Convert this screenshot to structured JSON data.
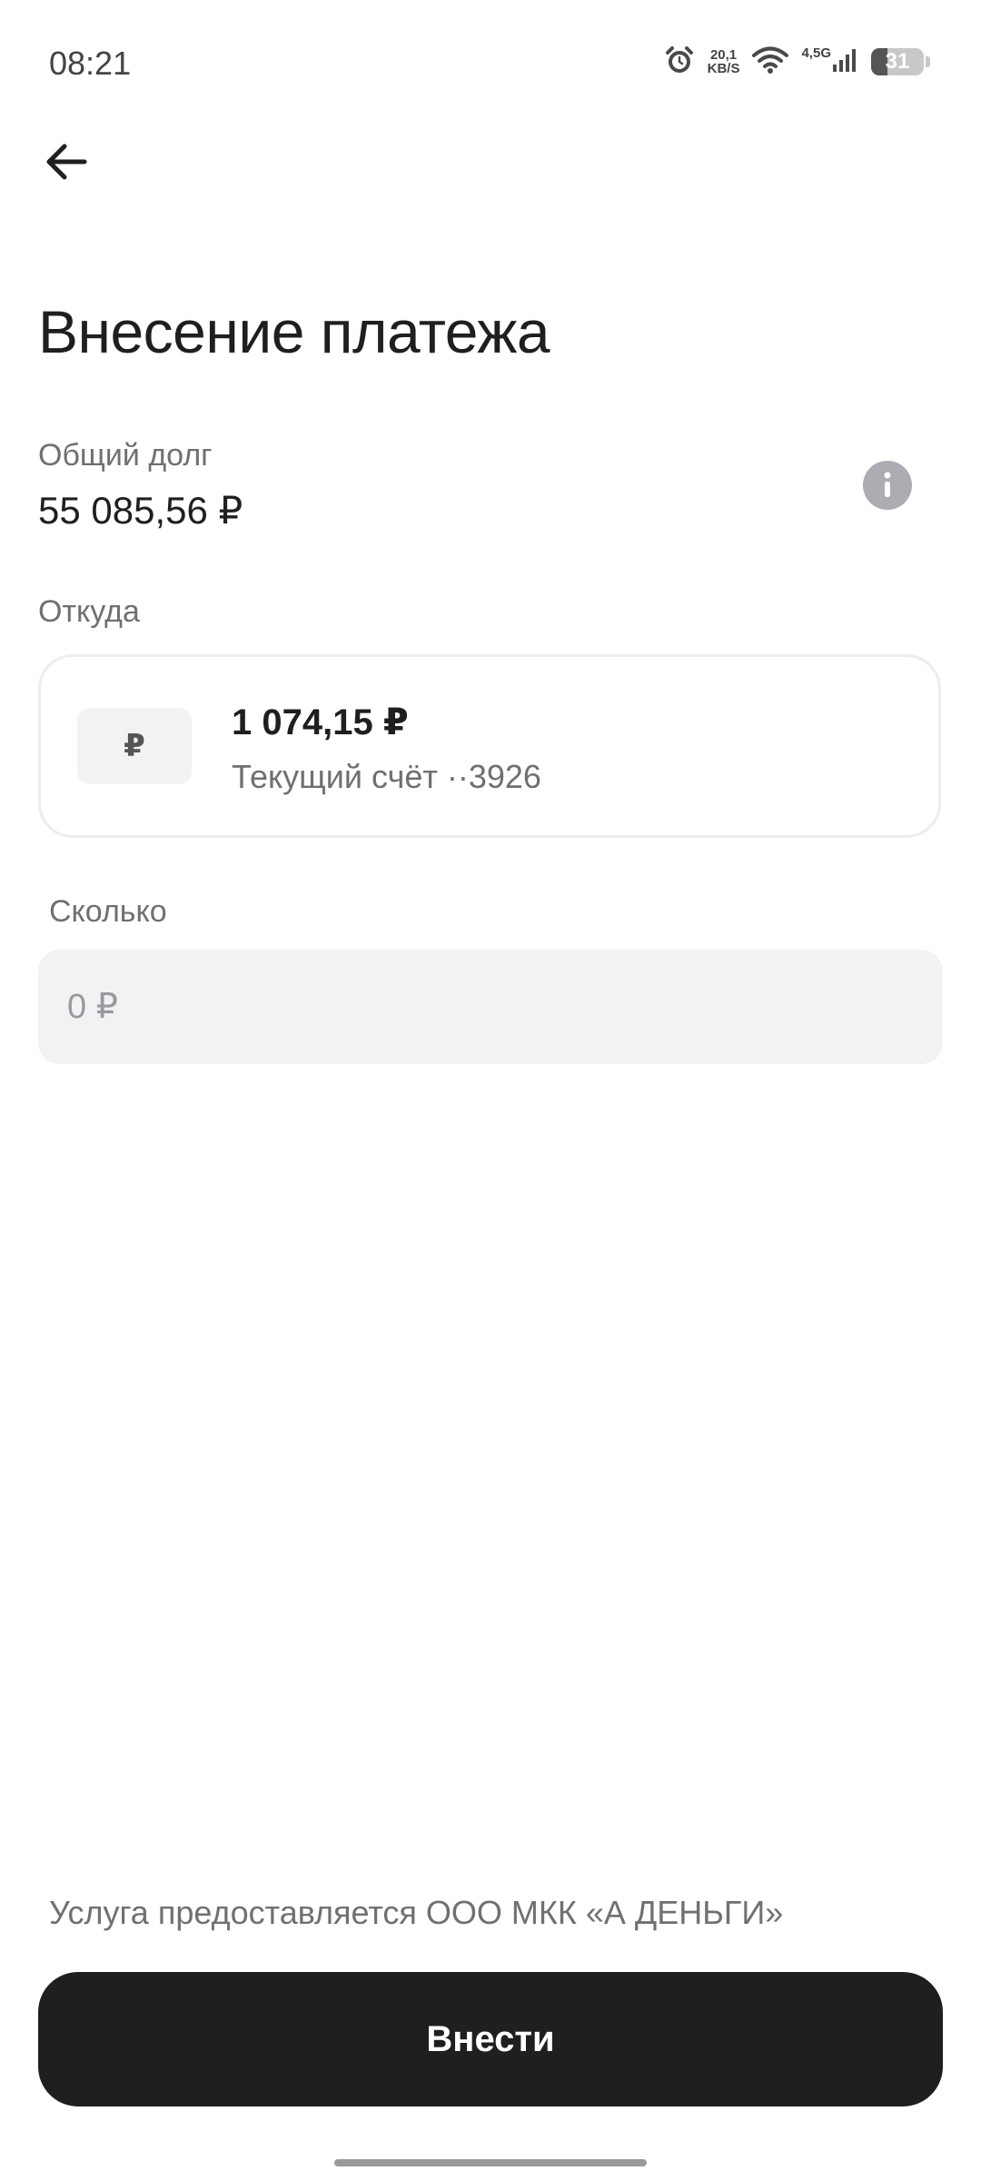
{
  "status_bar": {
    "time": "08:21",
    "net_speed_value": "20,1",
    "net_speed_unit": "KB/S",
    "network_type": "4,5G",
    "battery_level": "31",
    "icons": [
      "alarm-icon",
      "wifi-icon",
      "cellular-signal-icon",
      "battery-icon"
    ]
  },
  "header": {
    "back_icon": "arrow-left-icon"
  },
  "page": {
    "title": "Внесение платежа"
  },
  "debt": {
    "label": "Общий долг",
    "value": "55 085,56 ₽",
    "info_icon": "info-icon"
  },
  "source": {
    "label": "Откуда",
    "currency_symbol": "₽",
    "balance": "1 074,15 ₽",
    "account_name": "Текущий счёт ··3926"
  },
  "amount": {
    "label": "Сколько",
    "value": "",
    "placeholder": "0 ₽"
  },
  "footer": {
    "service_note": "Услуга предоставляется ООО МКК «А ДЕНЬГИ»",
    "submit_label": "Внести"
  },
  "colors": {
    "primary_button": "#1f1f21",
    "field_background": "#f1f2f4",
    "secondary_text": "#707070",
    "info_icon": "#acadb3"
  }
}
